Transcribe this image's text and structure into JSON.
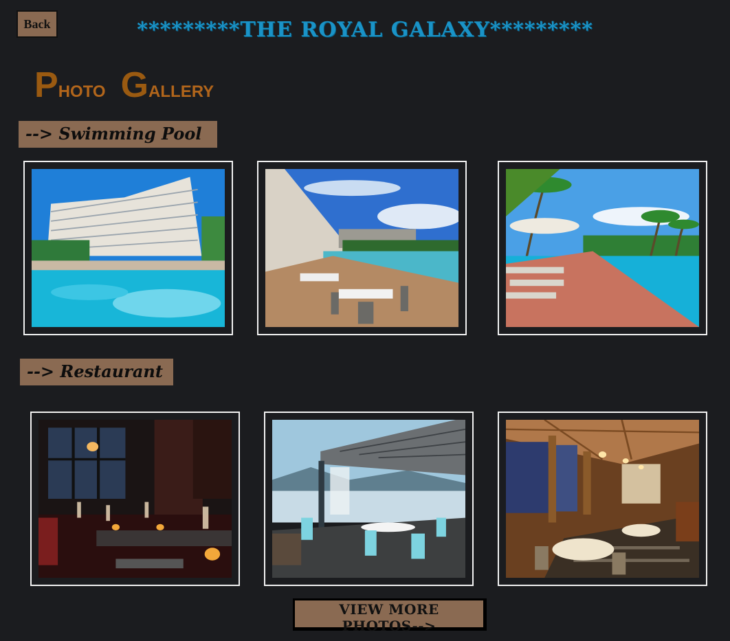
{
  "header": {
    "back_label": "Back",
    "title": "*********THE ROYAL GALAXY*********"
  },
  "gallery_heading": {
    "word1_initial": "P",
    "word1_rest": "HOTO",
    "word2_initial": "G",
    "word2_rest": "ALLERY"
  },
  "sections": {
    "pool": {
      "label": "--> Swimming Pool"
    },
    "restaurant": {
      "label": "--> Restaurant"
    }
  },
  "photos": {
    "pool_1": "hotel-pool-photo",
    "pool_2": "poolside-dining-photo",
    "pool_3": "beach-pool-loungers-photo",
    "rest_1": "candlelit-dining-photo",
    "rest_2": "terrace-restaurant-photo",
    "rest_3": "grand-dining-hall-photo"
  },
  "footer": {
    "view_more_label": "VIEW MORE PHOTOS-->"
  },
  "colors": {
    "background": "#1b1c1f",
    "title": "#1a93c7",
    "heading": "#9a5a11",
    "label_bg": "#8a6a52"
  }
}
